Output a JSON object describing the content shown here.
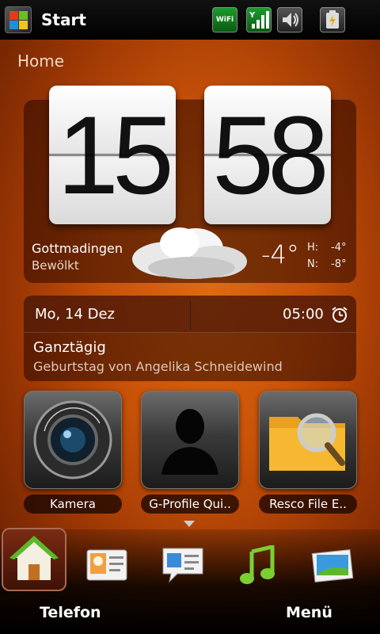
{
  "statusbar": {
    "title": "Start",
    "wifi_label": "WiFi",
    "icons": [
      "windows-start-icon",
      "wifi-icon",
      "signal-icon",
      "volume-icon",
      "battery-charging-icon"
    ]
  },
  "home_label": "Home",
  "clock": {
    "hour": "15",
    "minute": "58"
  },
  "weather": {
    "city": "Gottmadingen",
    "condition": "Bewölkt",
    "temp": "-4°",
    "high_label": "H:",
    "high": "-4°",
    "low_label": "N:",
    "low": "-8°"
  },
  "calendar": {
    "date": "Mo, 14 Dez",
    "alarm_time": "05:00",
    "event_title": "Ganztägig",
    "event_desc": "Geburtstag von Angelika Schneidewind"
  },
  "apps": [
    {
      "label": "Kamera",
      "icon": "camera-icon"
    },
    {
      "label": "G-Profile Qui..",
      "icon": "profile-silhouette-icon"
    },
    {
      "label": "Resco File E..",
      "icon": "folder-search-icon"
    }
  ],
  "dock": {
    "items": [
      "home-icon",
      "contacts-icon",
      "messages-icon",
      "music-icon",
      "photos-icon"
    ],
    "left_softkey": "Telefon",
    "right_softkey": "Menü"
  },
  "colors": {
    "accent": "#d35a08",
    "background_dark": "#5e1c02",
    "green": "#1c9c2c"
  }
}
